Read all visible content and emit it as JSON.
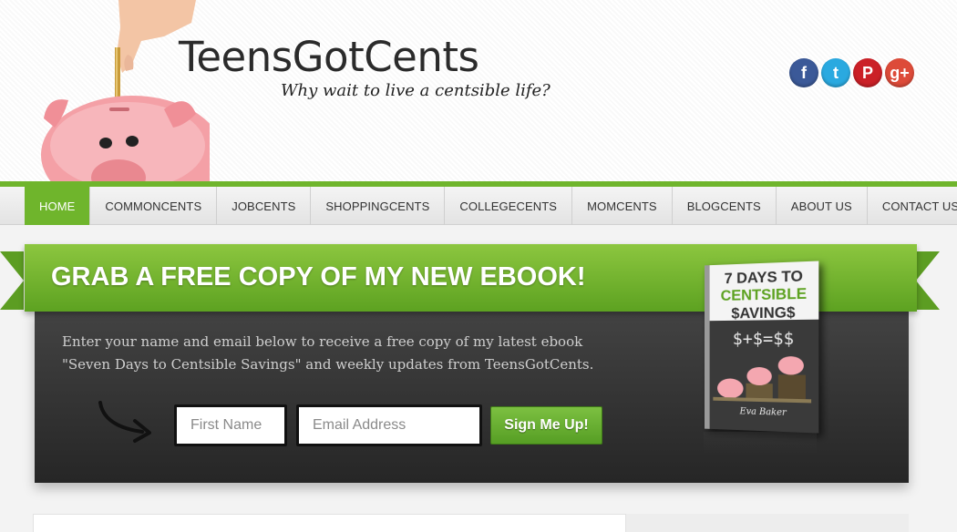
{
  "header": {
    "site_title": "TeensGotCents",
    "tagline": "Why wait to live a centsible life?"
  },
  "social": [
    {
      "name": "facebook-icon",
      "glyph": "f",
      "color": "#3b5998"
    },
    {
      "name": "twitter-icon",
      "glyph": "t",
      "color": "#2aa9e0"
    },
    {
      "name": "pinterest-icon",
      "glyph": "P",
      "color": "#cb2027"
    },
    {
      "name": "google-plus-icon",
      "glyph": "g+",
      "color": "#dd4b39"
    }
  ],
  "nav": {
    "items": [
      {
        "label": "HOME",
        "active": true
      },
      {
        "label": "COMMONCENTS"
      },
      {
        "label": "JOBCENTS"
      },
      {
        "label": "SHOPPINGCENTS"
      },
      {
        "label": "COLLEGECENTS"
      },
      {
        "label": "MOMCENTS"
      },
      {
        "label": "BLOGCENTS"
      },
      {
        "label": "ABOUT US"
      },
      {
        "label": "CONTACT US"
      }
    ]
  },
  "ebook": {
    "banner_title": "GRAB A FREE COPY OF MY NEW EBOOK!",
    "description": "Enter your name and email below to receive a free copy of my latest ebook \"Seven Days to Centsible Savings\" and weekly updates from TeensGotCents.",
    "first_name_placeholder": "First Name",
    "email_placeholder": "Email Address",
    "signup_label": "Sign Me Up!",
    "cover": {
      "line1": "7 DAYS TO",
      "line2": "CENTSIBLE",
      "line3": "$AVING$",
      "math": "$+$=$$",
      "author": "Eva Baker"
    }
  },
  "colors": {
    "accent_green": "#6fb52c",
    "panel_dark": "#2f2f2f"
  }
}
